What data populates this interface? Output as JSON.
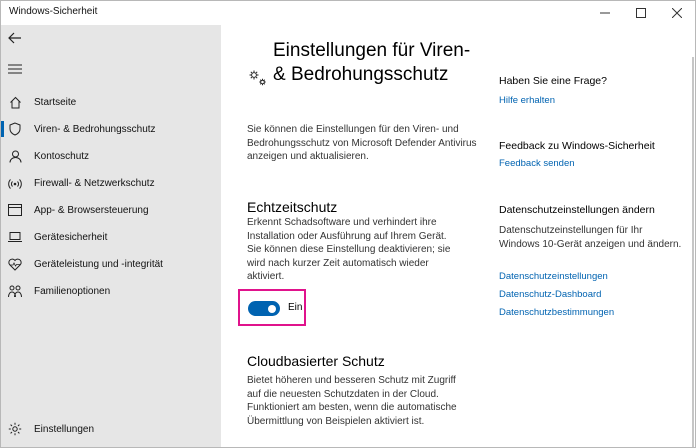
{
  "window": {
    "title": "Windows-Sicherheit",
    "controls": {
      "minimize": "–",
      "maximize": "☐",
      "close": "✕"
    }
  },
  "sidebar": {
    "items": [
      {
        "label": "Startseite",
        "icon": "home-icon"
      },
      {
        "label": "Viren- & Bedrohungsschutz",
        "icon": "shield-icon",
        "active": true
      },
      {
        "label": "Kontoschutz",
        "icon": "person-icon"
      },
      {
        "label": "Firewall- & Netzwerkschutz",
        "icon": "network-icon"
      },
      {
        "label": "App- & Browsersteuerung",
        "icon": "browser-icon"
      },
      {
        "label": "Gerätesicherheit",
        "icon": "laptop-icon"
      },
      {
        "label": "Geräteleistung und -integrität",
        "icon": "heart-icon"
      },
      {
        "label": "Familienoptionen",
        "icon": "family-icon"
      }
    ],
    "settings": {
      "label": "Einstellungen",
      "icon": "gear-icon"
    }
  },
  "main": {
    "title": "Einstellungen für Viren- & Bedrohungsschutz",
    "intro": "Sie können die Einstellungen für den Viren- und Bedrohungsschutz von Microsoft Defender Antivirus anzeigen und aktualisieren.",
    "realtime": {
      "title": "Echtzeitschutz",
      "text": "Erkennt Schadsoftware und verhindert ihre Installation oder Ausführung auf Ihrem Gerät. Sie können diese Einstellung deaktivieren; sie wird nach kurzer Zeit automatisch wieder aktiviert.",
      "toggle_label": "Ein",
      "toggle_on": true,
      "accent": "#0063b1",
      "highlight": "#e0138c"
    },
    "cloud": {
      "title": "Cloudbasierter Schutz",
      "text": "Bietet höheren und besseren Schutz mit Zugriff auf die neuesten Schutzdaten in der Cloud. Funktioniert am besten, wenn die automatische Übermittlung von Beispielen aktiviert ist."
    }
  },
  "aside": {
    "question": {
      "title": "Haben Sie eine Frage?",
      "link": "Hilfe erhalten"
    },
    "feedback": {
      "title": "Feedback zu Windows-Sicherheit",
      "link": "Feedback senden"
    },
    "privacy": {
      "title": "Datenschutzeinstellungen ändern",
      "text": "Datenschutzeinstellungen für Ihr Windows 10-Gerät anzeigen und ändern.",
      "links": [
        "Datenschutzeinstellungen",
        "Datenschutz-Dashboard",
        "Datenschutzbestimmungen"
      ]
    }
  }
}
